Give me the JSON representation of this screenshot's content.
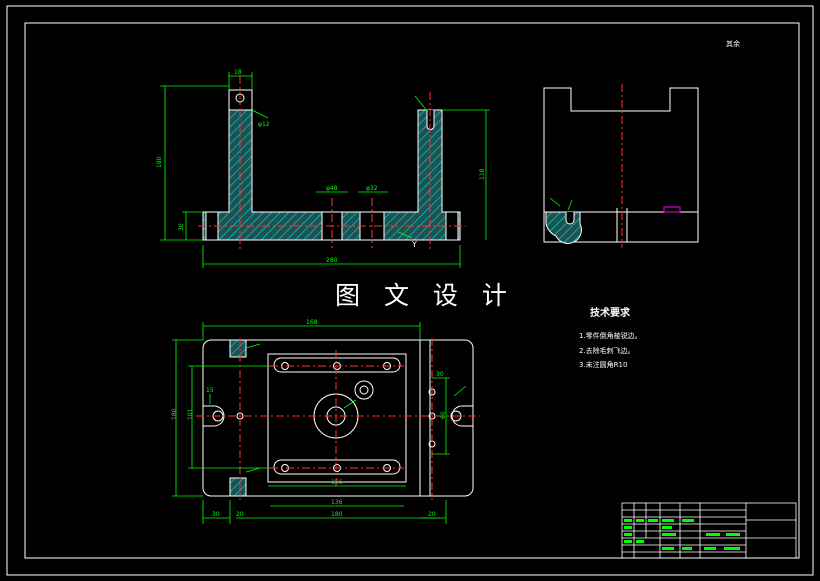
{
  "watermark": "图 文 设 计",
  "roughness_note": "其余",
  "tech_requirements": {
    "title": "技术要求",
    "items": [
      "1.零件倒角棱锐边。",
      "2.去除毛刺飞边。",
      "3.未注圆角R10"
    ]
  },
  "front_view_dims": {
    "overall_length": "280",
    "height_left": "180",
    "height_right": "118",
    "base": "30",
    "slot_a": "φ48",
    "slot_b": "φ32",
    "hole": "φ12",
    "top": "18",
    "y_label": "Y"
  },
  "plan_view_dims": {
    "top": "168",
    "bottom_a": "136",
    "bottom_b": "180",
    "inner": "166",
    "left_a": "30",
    "left_b": "20",
    "right": "20",
    "height_a": "180",
    "height_b": "101",
    "side_a": "15",
    "side_b": "30",
    "side_c": "60"
  },
  "colors": {
    "border": "#ffffff",
    "outline": "#ffffff",
    "dimension": "#00ff00",
    "centerline": "#ff3030",
    "hatch": "#00cccc",
    "part_fill": "#1f5151",
    "highlight": "#ff00ff"
  }
}
